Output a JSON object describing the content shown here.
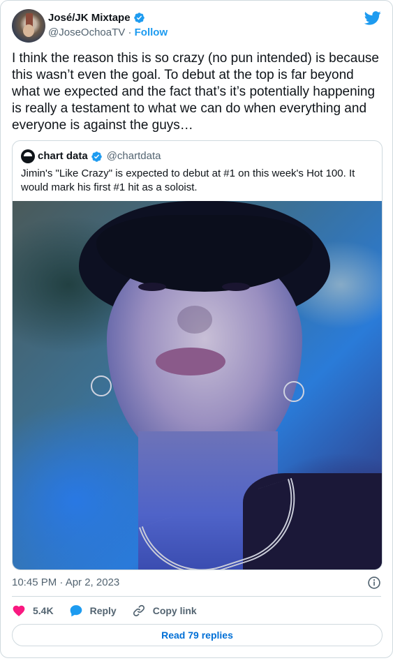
{
  "author": {
    "display_name": "José/JK Mixtape",
    "handle": "@JoseOchoaTV",
    "separator": "·",
    "follow_label": "Follow"
  },
  "tweet": {
    "text": "I think the reason this is so crazy (no pun intended) is because this wasn’t even the goal. To debut at the top is far beyond what we expected and the fact that’s it’s potentially happening is really a testament to what we can do when everything and everyone is against the guys…"
  },
  "quoted": {
    "display_name": "chart data",
    "handle": "@chartdata",
    "text": "Jimin's \"Like Crazy\" is expected to debut at #1 on this week's Hot 100. It would mark his first #1 hit as a soloist."
  },
  "timestamp": "10:45 PM · Apr 2, 2023",
  "actions": {
    "likes": "5.4K",
    "reply_label": "Reply",
    "copy_link_label": "Copy link"
  },
  "read_replies_label": "Read 79 replies",
  "colors": {
    "accent": "#1d9bf0",
    "like": "#f91880",
    "muted_text": "#536471",
    "border": "#cfd9de"
  },
  "icons": [
    "verified-badge-icon",
    "twitter-bird-icon",
    "info-icon",
    "heart-icon",
    "reply-bubble-icon",
    "link-icon"
  ]
}
